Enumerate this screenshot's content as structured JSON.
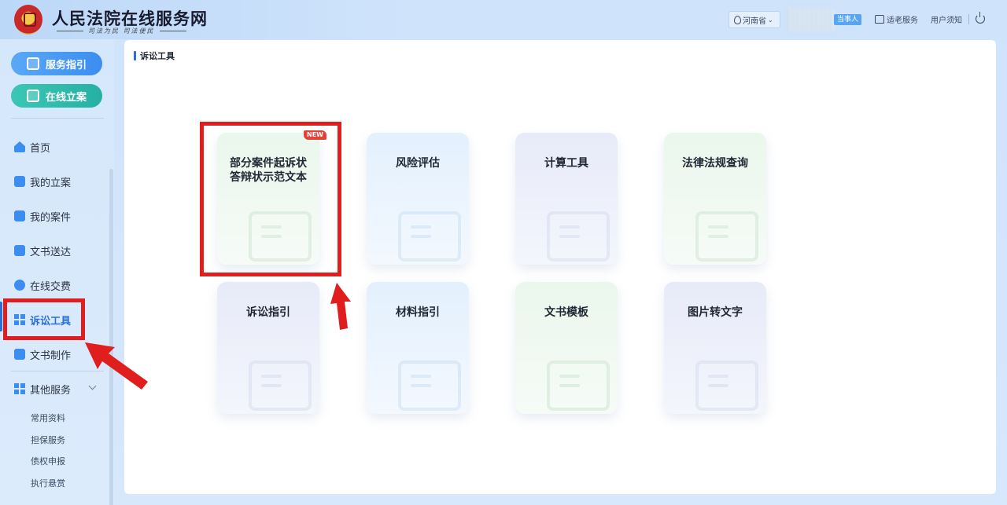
{
  "header": {
    "title": "人民法院在线服务网",
    "slogan": "司法为民  司法便民",
    "region": "河南省",
    "role_badge": "当事人",
    "links": [
      "适老服务",
      "用户须知"
    ]
  },
  "sidebar": {
    "pill_buttons": [
      "服务指引",
      "在线立案"
    ],
    "items": [
      {
        "label": "首页",
        "icon": "home-icon"
      },
      {
        "label": "我的立案",
        "icon": "edit-doc-icon"
      },
      {
        "label": "我的案件",
        "icon": "clipboard-icon"
      },
      {
        "label": "文书送达",
        "icon": "message-icon"
      },
      {
        "label": "在线交费",
        "icon": "coin-icon"
      },
      {
        "label": "诉讼工具",
        "icon": "grid-icon",
        "active": true
      },
      {
        "label": "文书制作",
        "icon": "document-icon"
      },
      {
        "label": "其他服务",
        "icon": "apps-icon"
      }
    ],
    "sub_items": [
      "常用资料",
      "担保服务",
      "债权申报",
      "执行悬赏"
    ]
  },
  "main": {
    "breadcrumb": "诉讼工具",
    "new_badge": "NEW",
    "tools": [
      {
        "label": "部分案件起诉状答辩状示范文本",
        "icon": "book-icon",
        "theme": "green"
      },
      {
        "label": "风险评估",
        "icon": "clipboard-check-icon",
        "theme": "blue"
      },
      {
        "label": "计算工具",
        "icon": "calculator-icon",
        "theme": "purple"
      },
      {
        "label": "法律法规查询",
        "icon": "search-doc-icon",
        "theme": "green"
      },
      {
        "label": "诉讼指引",
        "icon": "gavel-icon",
        "theme": "purple"
      },
      {
        "label": "材料指引",
        "icon": "files-icon",
        "theme": "blue"
      },
      {
        "label": "文书模板",
        "icon": "template-icon",
        "theme": "green"
      },
      {
        "label": "图片转文字",
        "icon": "translate-icon",
        "theme": "purple"
      }
    ]
  },
  "colors": {
    "accent": "#2a6fd6",
    "highlight": "#e01e1e"
  }
}
